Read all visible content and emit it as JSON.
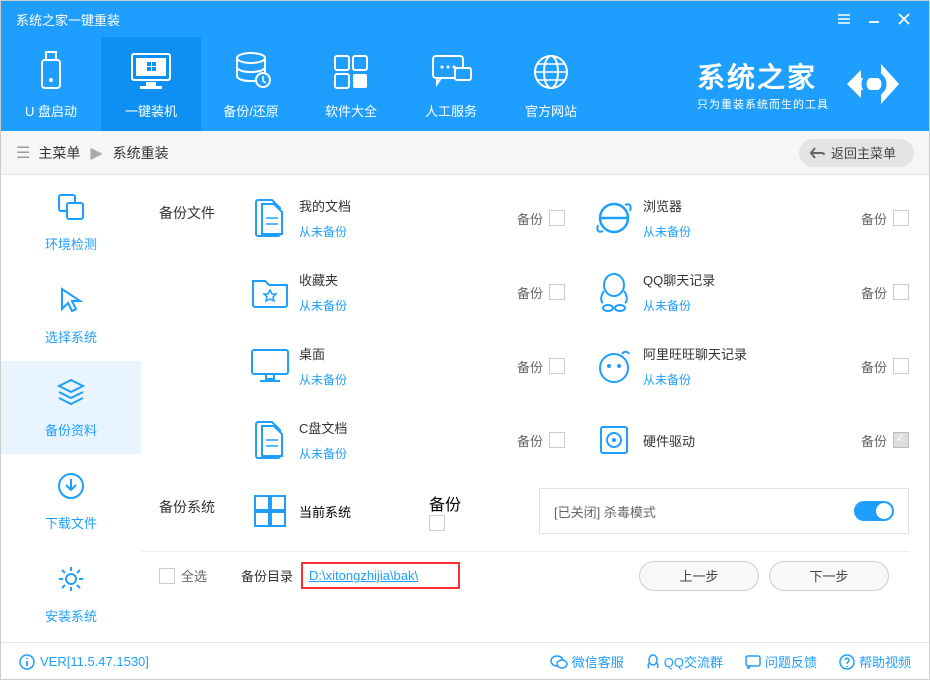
{
  "window": {
    "title": "系统之家一键重装"
  },
  "header": {
    "tabs": [
      {
        "label": "U 盘启动"
      },
      {
        "label": "一键装机"
      },
      {
        "label": "备份/还原"
      },
      {
        "label": "软件大全"
      },
      {
        "label": "人工服务"
      },
      {
        "label": "官方网站"
      }
    ],
    "brand_big": "系统之家",
    "brand_sm": "只为重装系统而生的工具"
  },
  "breadcrumb": {
    "main_label": "主菜单",
    "current": "系统重装",
    "back": "返回主菜单"
  },
  "steps": [
    {
      "label": "环境检测"
    },
    {
      "label": "选择系统"
    },
    {
      "label": "备份资料"
    },
    {
      "label": "下载文件"
    },
    {
      "label": "安装系统"
    }
  ],
  "sections": {
    "files_label": "备份文件",
    "system_label": "备份系统",
    "backup_action": "备份",
    "items": [
      {
        "name": "我的文档",
        "status": "从未备份"
      },
      {
        "name": "浏览器",
        "status": "从未备份"
      },
      {
        "name": "收藏夹",
        "status": "从未备份"
      },
      {
        "name": "QQ聊天记录",
        "status": "从未备份"
      },
      {
        "name": "桌面",
        "status": "从未备份"
      },
      {
        "name": "阿里旺旺聊天记录",
        "status": "从未备份"
      },
      {
        "name": "C盘文档",
        "status": "从未备份"
      },
      {
        "name": "硬件驱动",
        "status": ""
      }
    ],
    "current_system": "当前系统",
    "kill_mode": "[已关闭] 杀毒模式"
  },
  "bottom": {
    "select_all": "全选",
    "dir_label": "备份目录",
    "dir_path": "D:\\xitongzhijia\\bak\\",
    "prev": "上一步",
    "next": "下一步"
  },
  "footer": {
    "version": "VER[11.5.47.1530]",
    "links": [
      {
        "label": "微信客服"
      },
      {
        "label": "QQ交流群"
      },
      {
        "label": "问题反馈"
      },
      {
        "label": "帮助视频"
      }
    ]
  }
}
